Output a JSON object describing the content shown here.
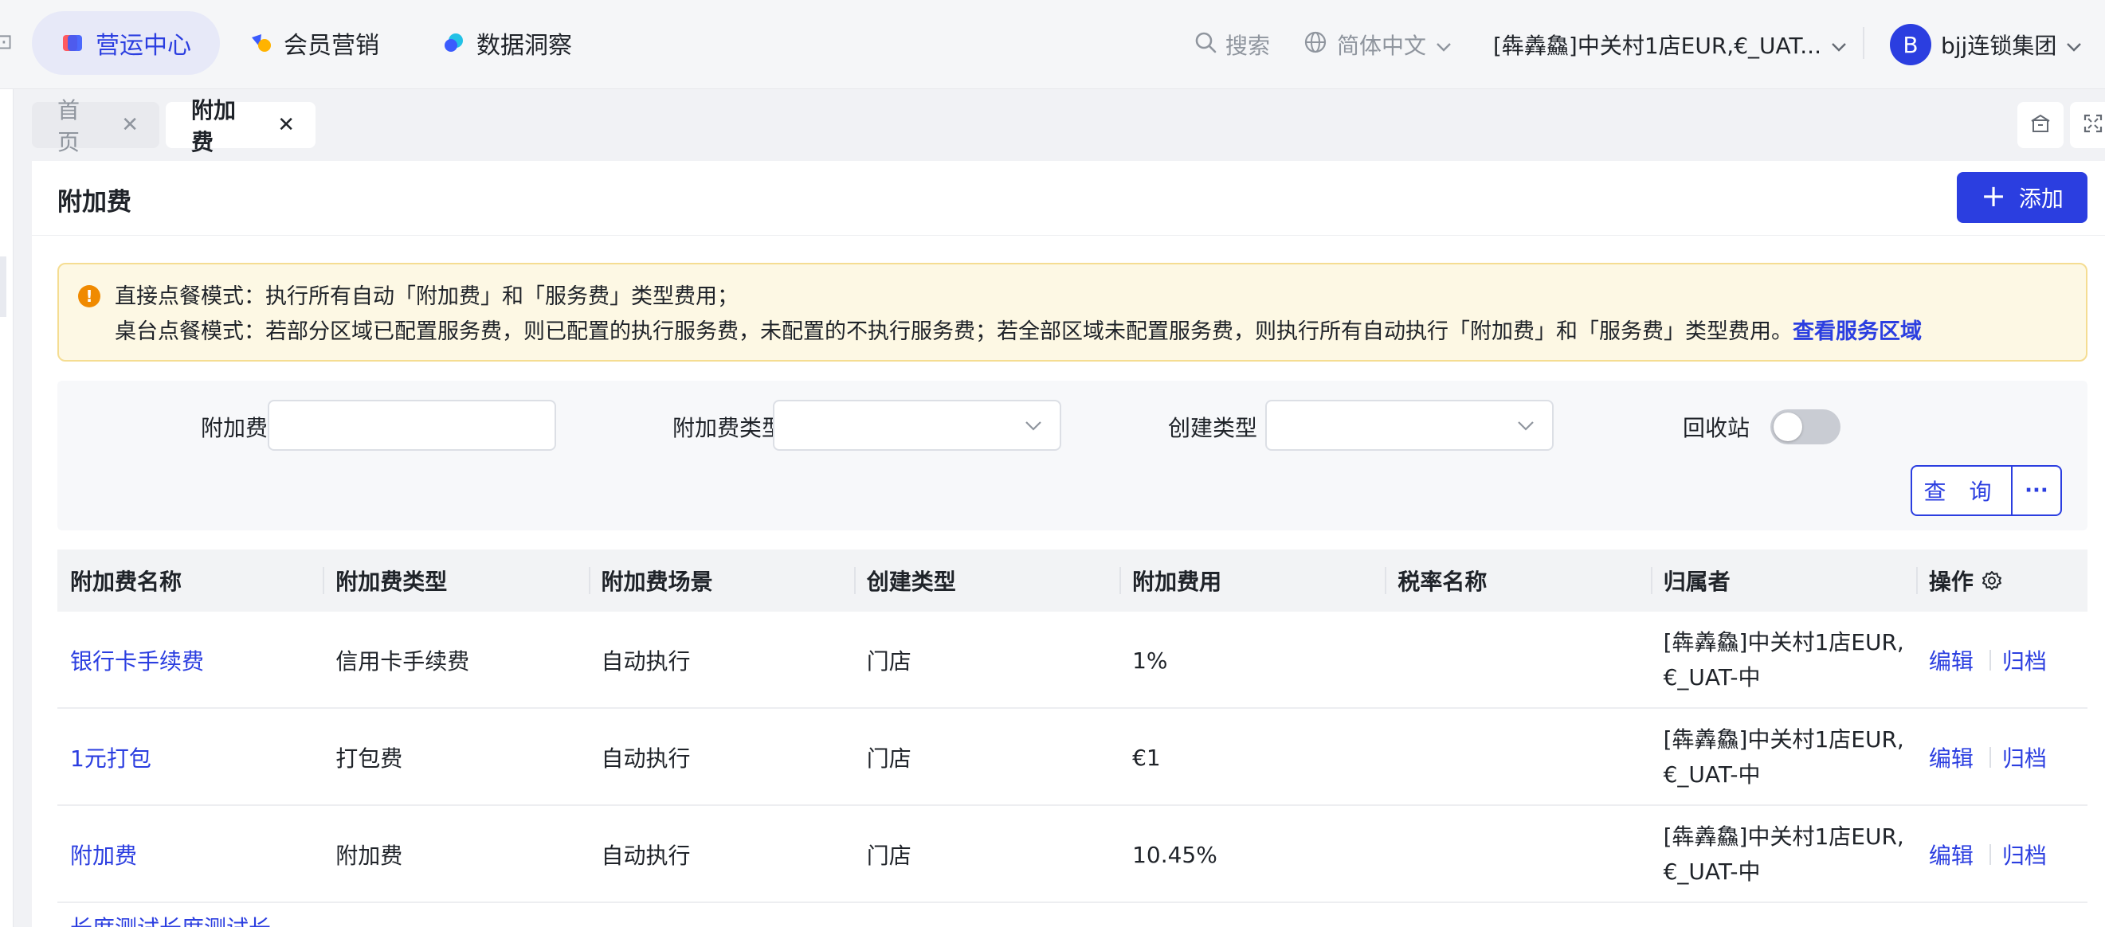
{
  "topnav": {
    "items": [
      {
        "label": "营运中心",
        "active": true,
        "icon": "operation-center-icon"
      },
      {
        "label": "会员营销",
        "active": false,
        "icon": "member-marketing-icon"
      },
      {
        "label": "数据洞察",
        "active": false,
        "icon": "data-insight-icon"
      }
    ],
    "search_label": "搜索",
    "language_label": "简体中文",
    "store_label": "[犇羴鱻]中关村1店EUR,€_UAT...",
    "avatar_initial": "B",
    "org_name": "bjj连锁集团"
  },
  "tabs": [
    {
      "label": "首页",
      "active": false
    },
    {
      "label": "附加费",
      "active": true
    }
  ],
  "page": {
    "title": "附加费",
    "add_button": "添加"
  },
  "notice": {
    "line1": "直接点餐模式：执行所有自动「附加费」和「服务费」类型费用；",
    "line2": "桌台点餐模式：若部分区域已配置服务费，则已配置的执行服务费，未配置的不执行服务费；若全部区域未配置服务费，则执行所有自动执行「附加费」和「服务费」类型费用。",
    "link": "查看服务区域"
  },
  "filters": {
    "name_label": "附加费名称",
    "name_value": "",
    "type_label": "附加费类型",
    "create_type_label": "创建类型",
    "recycle_label": "回收站",
    "recycle_on": false,
    "query_button": "查 询",
    "more_button": "···"
  },
  "table": {
    "columns": [
      "附加费名称",
      "附加费类型",
      "附加费场景",
      "创建类型",
      "附加费用",
      "税率名称",
      "归属者",
      "操作"
    ],
    "rows": [
      {
        "name": "银行卡手续费",
        "type": "信用卡手续费",
        "scene": "自动执行",
        "create_type": "门店",
        "fee": "1%",
        "tax": "",
        "owner": "[犇羴鱻]中关村1店EUR,\n€_UAT-中",
        "edit": "编辑",
        "archive": "归档"
      },
      {
        "name": "1元打包",
        "type": "打包费",
        "scene": "自动执行",
        "create_type": "门店",
        "fee": "€1",
        "tax": "",
        "owner": "[犇羴鱻]中关村1店EUR,\n€_UAT-中",
        "edit": "编辑",
        "archive": "归档"
      },
      {
        "name": "附加费",
        "type": "附加费",
        "scene": "自动执行",
        "create_type": "门店",
        "fee": "10.45%",
        "tax": "",
        "owner": "[犇羴鱻]中关村1店EUR,\n€_UAT-中",
        "edit": "编辑",
        "archive": "归档"
      }
    ],
    "partial_row_name": "长度测试长度测试长"
  }
}
